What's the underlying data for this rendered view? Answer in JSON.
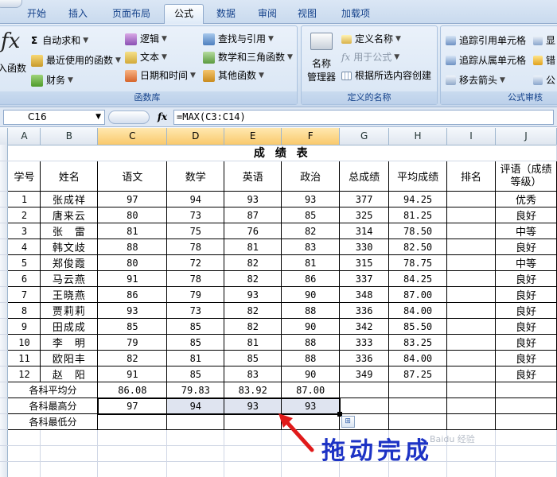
{
  "ribbon": {
    "tabs": [
      {
        "label": "开始",
        "active": false
      },
      {
        "label": "插入",
        "active": false
      },
      {
        "label": "页面布局",
        "active": false
      },
      {
        "label": "公式",
        "active": true
      },
      {
        "label": "数据",
        "active": false
      },
      {
        "label": "审阅",
        "active": false
      },
      {
        "label": "视图",
        "active": false
      },
      {
        "label": "加载项",
        "active": false
      }
    ],
    "groups": {
      "function_library": {
        "title": "函数库",
        "insert_function": "入函数",
        "fx_symbol": "fx",
        "autosum": "自动求和",
        "recent": "最近使用的函数",
        "financial": "财务",
        "logical": "逻辑",
        "text": "文本",
        "datetime": "日期和时间",
        "lookup": "查找与引用",
        "math": "数学和三角函数",
        "more": "其他函数"
      },
      "defined_names": {
        "title": "定义的名称",
        "name_manager_1": "名称",
        "name_manager_2": "管理器",
        "define_name": "定义名称",
        "use_in_formula": "用于公式",
        "create_from_selection": "根据所选内容创建"
      },
      "formula_auditing": {
        "title": "公式审核",
        "trace_precedents": "追踪引用单元格",
        "trace_dependents": "追踪从属单元格",
        "remove_arrows": "移去箭头",
        "show": "显",
        "error": "错",
        "watch": "公"
      }
    }
  },
  "formula_bar": {
    "name_box": "C16",
    "fx": "fx",
    "formula": "=MAX(C3:C14)"
  },
  "columns": [
    "A",
    "B",
    "C",
    "D",
    "E",
    "F",
    "G",
    "H",
    "I",
    "J"
  ],
  "sheet": {
    "title": "成 绩 表",
    "headers": [
      "学号",
      "姓名",
      "语文",
      "数学",
      "英语",
      "政治",
      "总成绩",
      "平均成绩",
      "排名",
      "评语（成绩等级）"
    ],
    "rows": [
      [
        "1",
        "张成祥",
        "97",
        "94",
        "93",
        "93",
        "377",
        "94.25",
        "",
        "优秀"
      ],
      [
        "2",
        "唐来云",
        "80",
        "73",
        "87",
        "85",
        "325",
        "81.25",
        "",
        "良好"
      ],
      [
        "3",
        "张　雷",
        "81",
        "75",
        "76",
        "82",
        "314",
        "78.50",
        "",
        "中等"
      ],
      [
        "4",
        "韩文歧",
        "88",
        "78",
        "81",
        "83",
        "330",
        "82.50",
        "",
        "良好"
      ],
      [
        "5",
        "郑俊霞",
        "80",
        "72",
        "82",
        "81",
        "315",
        "78.75",
        "",
        "中等"
      ],
      [
        "6",
        "马云燕",
        "91",
        "78",
        "82",
        "86",
        "337",
        "84.25",
        "",
        "良好"
      ],
      [
        "7",
        "王晓燕",
        "86",
        "79",
        "93",
        "90",
        "348",
        "87.00",
        "",
        "良好"
      ],
      [
        "8",
        "贾莉莉",
        "93",
        "73",
        "82",
        "88",
        "336",
        "84.00",
        "",
        "良好"
      ],
      [
        "9",
        "田成成",
        "85",
        "85",
        "82",
        "90",
        "342",
        "85.50",
        "",
        "良好"
      ],
      [
        "10",
        "李　明",
        "79",
        "85",
        "81",
        "88",
        "333",
        "83.25",
        "",
        "良好"
      ],
      [
        "11",
        "欧阳丰",
        "82",
        "81",
        "85",
        "88",
        "336",
        "84.00",
        "",
        "良好"
      ],
      [
        "12",
        "赵　阳",
        "91",
        "85",
        "83",
        "90",
        "349",
        "87.25",
        "",
        "良好"
      ]
    ],
    "avg_label": "各科平均分",
    "avg_values": [
      "86.08",
      "79.83",
      "83.92",
      "87.00"
    ],
    "max_label": "各科最高分",
    "max_values": [
      "97",
      "94",
      "93",
      "93"
    ],
    "min_label": "各科最低分",
    "extra_row_count": 3
  },
  "annotation": {
    "text": "拖动完成",
    "color": "#1d33c5",
    "watermark": "Baidu 经验"
  }
}
